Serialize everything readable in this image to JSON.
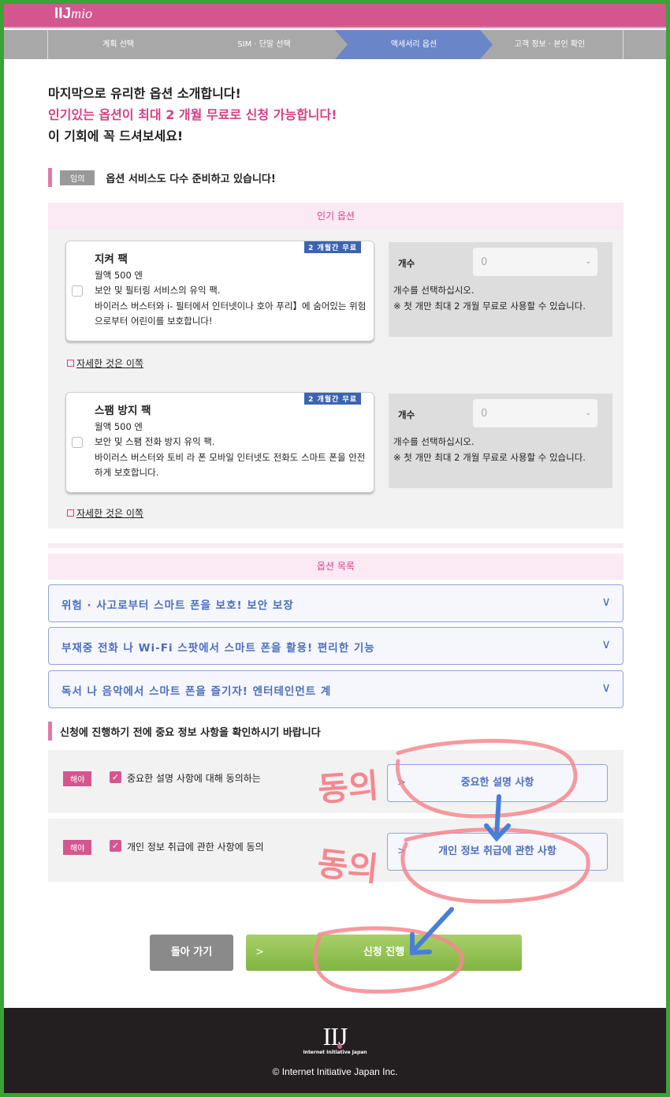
{
  "header": {
    "logo": "IIJ",
    "logo_suffix": "mio"
  },
  "steps": [
    {
      "label": "계획 선택",
      "active": false
    },
    {
      "label": "SIM · 단말 선택",
      "active": false
    },
    {
      "label": "액세서리 옵션",
      "active": true
    },
    {
      "label": "고객 정보 · 본인 확인",
      "active": false
    }
  ],
  "intro": {
    "line1": "마지막으로 유리한 옵션 소개합니다!",
    "line2": "인기있는 옵션이 최대 2 개월 무료로 신청 가능합니다!",
    "line3": "이 기회에 꼭 드셔보세요!"
  },
  "optional_section": {
    "tag": "임의",
    "title": "옵션 서비스도 다수 준비하고 있습니다!"
  },
  "popular": {
    "title": "인기 옵션",
    "items": [
      {
        "badge": "2 개월간 무료",
        "name": "지켜 팩",
        "price": "월액 500 엔",
        "desc1": "보안 및 필터링 서비스의 유익 팩.",
        "desc2": "바이러스 버스터와 i- 필터에서 인터넷이나 호아 푸리】에 숨어있는 위험으로부터 어린이를 보호합니다!",
        "qty_label": "개수",
        "qty_value": "0",
        "qty_note1": "개수를 선택하십시오.",
        "qty_note2": "※ 첫 개만 최대 2 개월 무료로 사용할 수 있습니다.",
        "more": "자세한 것은 이쪽",
        "checked": false
      },
      {
        "badge": "2 개월간 무료",
        "name": "스팸 방지 팩",
        "price": "월액 500 엔",
        "desc1": "보안 및 스팸 전화 방지 유익 팩.",
        "desc2": "바이러스 버스터와 토비 라 폰 모바일 인터넷도 전화도 스마트 폰을 안전하게 보호합니다.",
        "qty_label": "개수",
        "qty_value": "0",
        "qty_note1": "개수를 선택하십시오.",
        "qty_note2": "※ 첫 개만 최대 2 개월 무료로 사용할 수 있습니다.",
        "more": "자세한 것은 이쪽",
        "checked": false
      }
    ]
  },
  "option_list": {
    "title": "옵션 목록",
    "items": [
      "위험 · 사고로부터 스마트 폰을 보호! 보안 보장",
      "부재중 전화 나 Wi-Fi 스팟에서 스마트 폰을 활용! 편리한 기능",
      "독서 나 음악에서 스마트 폰을 즐기자! 엔터테인먼트 계"
    ]
  },
  "important": {
    "title": "신청에 진행하기 전에 중요 정보 사항을 확인하시기 바랍니다",
    "rows": [
      {
        "tag": "해야",
        "label": "중요한 설명 사항에 대해 동의하는",
        "checked": true,
        "button": "중요한 설명 사항"
      },
      {
        "tag": "해야",
        "label": "개인 정보 취급에 관한 사항에 동의",
        "checked": true,
        "button": "개인 정보 취급에 관한 사항"
      }
    ]
  },
  "actions": {
    "back": "돌아 가기",
    "proceed": "신청 진행"
  },
  "footer": {
    "logo": "IIJ",
    "logo_sub": "Internet Initiative Japan",
    "copyright": "© Internet Initiative Japan Inc."
  },
  "annotations": {
    "note1": "동의",
    "note2": "동의",
    "ink_red": "#f5888f",
    "ink_blue": "#4a7fd6"
  },
  "colors": {
    "brand_pink": "#d4568f",
    "active_step": "#6a85c8",
    "proceed_green": "#8fc04f",
    "frame_green": "#3aa335"
  }
}
